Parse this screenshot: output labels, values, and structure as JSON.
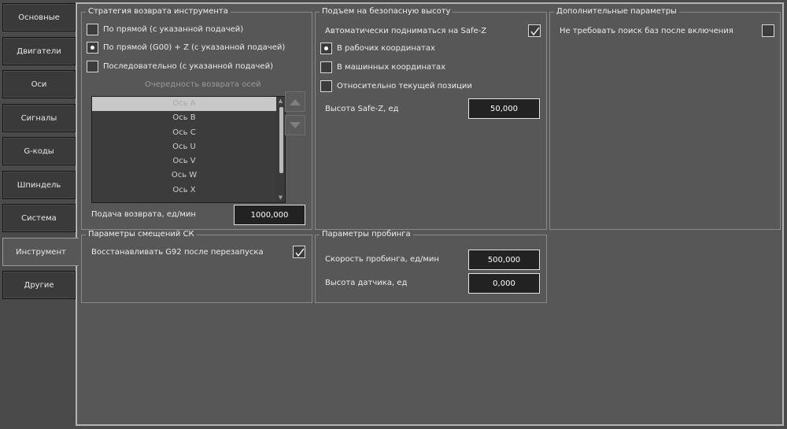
{
  "sidebar": {
    "items": [
      {
        "label": "Основные"
      },
      {
        "label": "Двигатели"
      },
      {
        "label": "Оси"
      },
      {
        "label": "Сигналы"
      },
      {
        "label": "G-коды"
      },
      {
        "label": "Шпиндель"
      },
      {
        "label": "Система"
      },
      {
        "label": "Инструмент"
      },
      {
        "label": "Другие"
      }
    ],
    "active": "Инструмент"
  },
  "tool_return": {
    "title": "Стратегия возврата инструмента",
    "options": [
      {
        "label": "По прямой (с указанной подачей)",
        "selected": false
      },
      {
        "label": "По прямой (G00) + Z (с указанной подачей)",
        "selected": true
      },
      {
        "label": "Последовательно (с указанной подачей)",
        "selected": false
      }
    ],
    "axis_order_label": "Очередность возврата осей",
    "axes": [
      "Ось A",
      "Ось B",
      "Ось C",
      "Ось U",
      "Ось V",
      "Ось W",
      "Ось X"
    ],
    "selected_axis": "Ось A",
    "feed_label": "Подача возврата, ед/мин",
    "feed_value": "1000,000"
  },
  "safe_height": {
    "title": "Подъем на безопасную высоту",
    "auto_label": "Автоматически подниматься на Safe-Z",
    "auto_checked": true,
    "coord_options": [
      {
        "label": "В рабочих координатах",
        "selected": true
      },
      {
        "label": "В машинных координатах",
        "selected": false
      },
      {
        "label": "Относительно текущей позиции",
        "selected": false
      }
    ],
    "safez_label": "Высота Safe-Z, ед",
    "safez_value": "50,000"
  },
  "extra": {
    "title": "Дополнительные параметры",
    "nobase_label": "Не требовать поиск баз после включения",
    "nobase_checked": false
  },
  "offsets": {
    "title": "Параметры смещений СК",
    "restore_label": "Восстанавливать G92 после перезапуска",
    "restore_checked": true
  },
  "probing": {
    "title": "Параметры пробинга",
    "speed_label": "Скорость пробинга, ед/мин",
    "speed_value": "500,000",
    "height_label": "Высота датчика, ед",
    "height_value": "0,000"
  },
  "colors": {
    "background": "#4a4a4a",
    "panel": "#575757",
    "input_bg": "#222222",
    "selected_row": "#c8c8c8"
  }
}
